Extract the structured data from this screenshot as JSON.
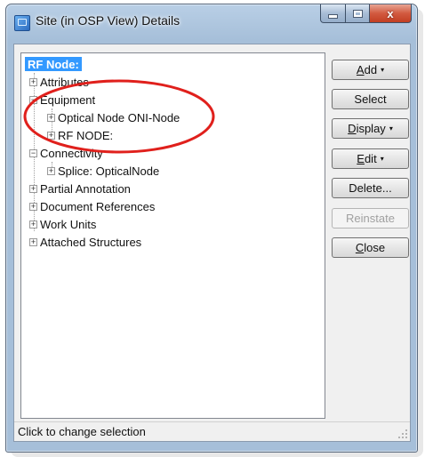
{
  "window": {
    "title": "Site (in OSP View) Details",
    "close_glyph": "x"
  },
  "tree": {
    "root": "RF Node:",
    "items": [
      {
        "label": "Attributes",
        "level": 1,
        "expander": "+"
      },
      {
        "label": "Equipment",
        "level": 1,
        "expander": "−"
      },
      {
        "label": "Optical Node ONI-Node",
        "level": 2,
        "expander": "+"
      },
      {
        "label": "RF NODE:",
        "level": 2,
        "expander": "+"
      },
      {
        "label": "Connectivity",
        "level": 1,
        "expander": "−"
      },
      {
        "label": "Splice: OpticalNode",
        "level": 2,
        "expander": "+"
      },
      {
        "label": "Partial Annotation",
        "level": 1,
        "expander": "+"
      },
      {
        "label": "Document References",
        "level": 1,
        "expander": "+"
      },
      {
        "label": "Work Units",
        "level": 1,
        "expander": "+"
      },
      {
        "label": "Attached Structures",
        "level": 1,
        "expander": "+"
      }
    ]
  },
  "buttons": {
    "add": {
      "label": "Add",
      "has_menu": true
    },
    "select": {
      "label": "Select"
    },
    "display": {
      "label": "Display",
      "has_menu": true
    },
    "edit": {
      "label": "Edit",
      "has_menu": true
    },
    "delete": {
      "label": "Delete..."
    },
    "reinstate": {
      "label": "Reinstate",
      "enabled": false
    },
    "close": {
      "label": "Close"
    }
  },
  "status_bar": {
    "text": "Click to change selection"
  },
  "icons": {
    "app": "site-details-app-icon",
    "caret": "▾"
  },
  "colors": {
    "selection": "#3399ff",
    "annotation": "#e0201c",
    "close_button": "#c23e22"
  }
}
